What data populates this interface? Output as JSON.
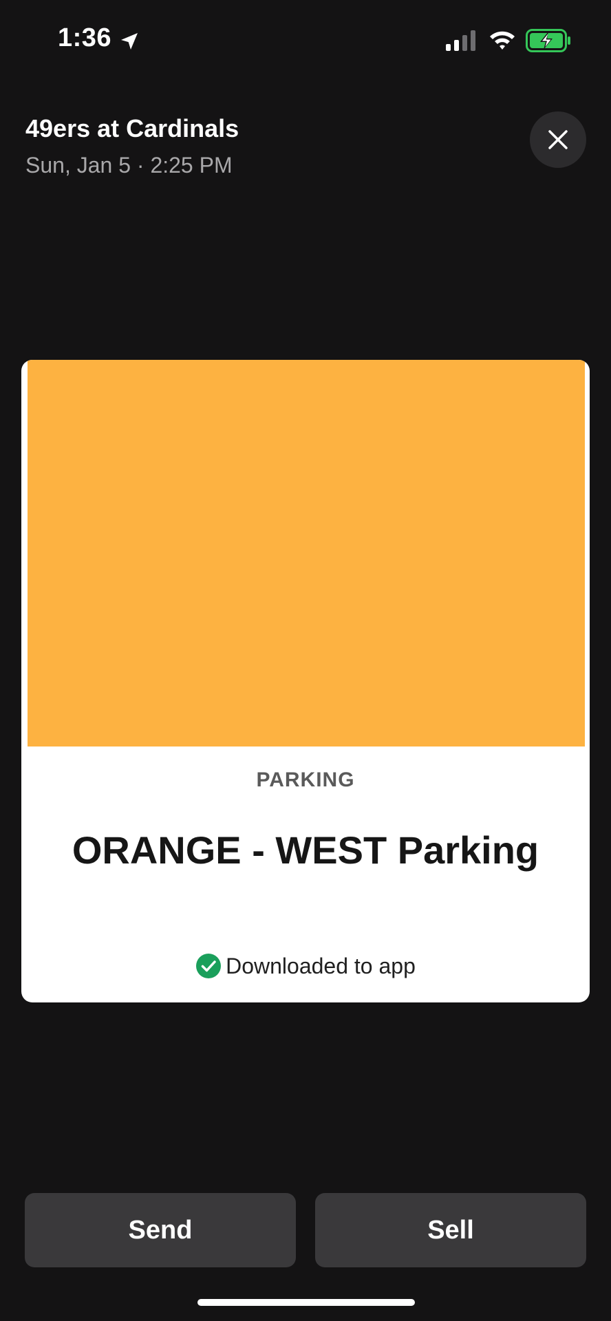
{
  "status_bar": {
    "time": "1:36",
    "icons": [
      "location-arrow-icon",
      "cellular-signal-icon",
      "wifi-icon",
      "battery-charging-icon"
    ],
    "battery_color": "#35c759"
  },
  "header": {
    "title": "49ers at Cardinals",
    "date": "Sun, Jan 5 · 2:25 PM",
    "close_icon": "close-icon"
  },
  "ticket": {
    "banner_color": "#fdb241",
    "category": "PARKING",
    "name": "ORANGE - WEST Parking",
    "status": "Downloaded to app",
    "status_icon": "check-circle-icon",
    "status_icon_color": "#1a9f5b"
  },
  "actions": {
    "send_label": "Send",
    "sell_label": "Sell"
  }
}
